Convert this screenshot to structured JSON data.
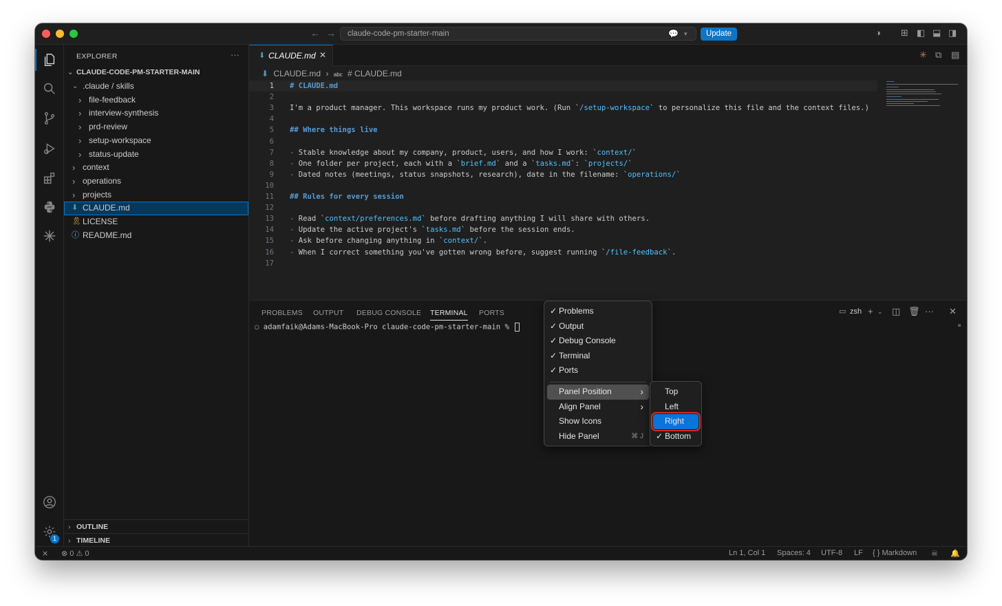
{
  "titlebar": {
    "search_text": "claude-code-pm-starter-main",
    "update_label": "Update"
  },
  "sidebar": {
    "title": "EXPLORER",
    "more": "···",
    "root": "CLAUDE-CODE-PM-STARTER-MAIN",
    "tree": [
      {
        "label": ".claude / skills",
        "indent": 1,
        "type": "folder-open"
      },
      {
        "label": "file-feedback",
        "indent": 2,
        "type": "folder"
      },
      {
        "label": "interview-synthesis",
        "indent": 2,
        "type": "folder"
      },
      {
        "label": "prd-review",
        "indent": 2,
        "type": "folder"
      },
      {
        "label": "setup-workspace",
        "indent": 2,
        "type": "folder"
      },
      {
        "label": "status-update",
        "indent": 2,
        "type": "folder"
      },
      {
        "label": "context",
        "indent": 1,
        "type": "folder"
      },
      {
        "label": "operations",
        "indent": 1,
        "type": "folder"
      },
      {
        "label": "projects",
        "indent": 1,
        "type": "folder"
      },
      {
        "label": "CLAUDE.md",
        "indent": 1,
        "type": "markdown",
        "selected": true
      },
      {
        "label": "LICENSE",
        "indent": 1,
        "type": "license"
      },
      {
        "label": "README.md",
        "indent": 1,
        "type": "info"
      }
    ],
    "outline": "OUTLINE",
    "timeline": "TIMELINE"
  },
  "editor": {
    "tab_label": "CLAUDE.md",
    "breadcrumb_file": "CLAUDE.md",
    "breadcrumb_symbol": "# CLAUDE.md",
    "lines": [
      {
        "n": "1",
        "text": "# CLAUDE.md"
      },
      {
        "n": "2",
        "text": ""
      },
      {
        "n": "3",
        "text": "I'm a product manager. This workspace runs my product work. (Run `/setup-workspace` to personalize this file and the context files.)"
      },
      {
        "n": "4",
        "text": ""
      },
      {
        "n": "5",
        "text": "## Where things live"
      },
      {
        "n": "6",
        "text": ""
      },
      {
        "n": "7",
        "text": "- Stable knowledge about my company, product, users, and how I work: `context/`"
      },
      {
        "n": "8",
        "text": "- One folder per project, each with a `brief.md` and a `tasks.md`: `projects/`"
      },
      {
        "n": "9",
        "text": "- Dated notes (meetings, status snapshots, research), date in the filename: `operations/`"
      },
      {
        "n": "10",
        "text": ""
      },
      {
        "n": "11",
        "text": "## Rules for every session"
      },
      {
        "n": "12",
        "text": ""
      },
      {
        "n": "13",
        "text": "- Read `context/preferences.md` before drafting anything I will share with others."
      },
      {
        "n": "14",
        "text": "- Update the active project's `tasks.md` before the session ends."
      },
      {
        "n": "15",
        "text": "- Ask before changing anything in `context/`."
      },
      {
        "n": "16",
        "text": "- When I correct something you've gotten wrong before, suggest running `/file-feedback`."
      },
      {
        "n": "17",
        "text": ""
      }
    ]
  },
  "panel": {
    "tabs": [
      "PROBLEMS",
      "OUTPUT",
      "DEBUG CONSOLE",
      "TERMINAL",
      "PORTS"
    ],
    "active_tab": "TERMINAL",
    "shell": "zsh",
    "prompt": "adamfaik@Adams-MacBook-Pro claude-code-pm-starter-main % "
  },
  "context_menu": {
    "items": [
      {
        "label": "Problems",
        "checked": true
      },
      {
        "label": "Output",
        "checked": true
      },
      {
        "label": "Debug Console",
        "checked": true
      },
      {
        "label": "Terminal",
        "checked": true
      },
      {
        "label": "Ports",
        "checked": true
      }
    ],
    "actions": [
      {
        "label": "Panel Position",
        "submenu": true
      },
      {
        "label": "Align Panel",
        "submenu": true
      },
      {
        "label": "Show Icons"
      },
      {
        "label": "Hide Panel",
        "shortcut": "⌘ J"
      }
    ],
    "check_mark": "✓",
    "submenu_arrow": "›"
  },
  "position_submenu": {
    "items": [
      {
        "label": "Top",
        "checked": false
      },
      {
        "label": "Left",
        "checked": false
      },
      {
        "label": "Right",
        "checked": false,
        "highlighted": true
      },
      {
        "label": "Bottom",
        "checked": true
      }
    ]
  },
  "statusbar": {
    "errors": "0",
    "warnings": "0",
    "cursor": "Ln 1, Col 1",
    "spaces": "Spaces: 4",
    "encoding": "UTF-8",
    "eol": "LF",
    "language": "{ } Markdown"
  },
  "activity": {
    "badge_count": "1"
  }
}
